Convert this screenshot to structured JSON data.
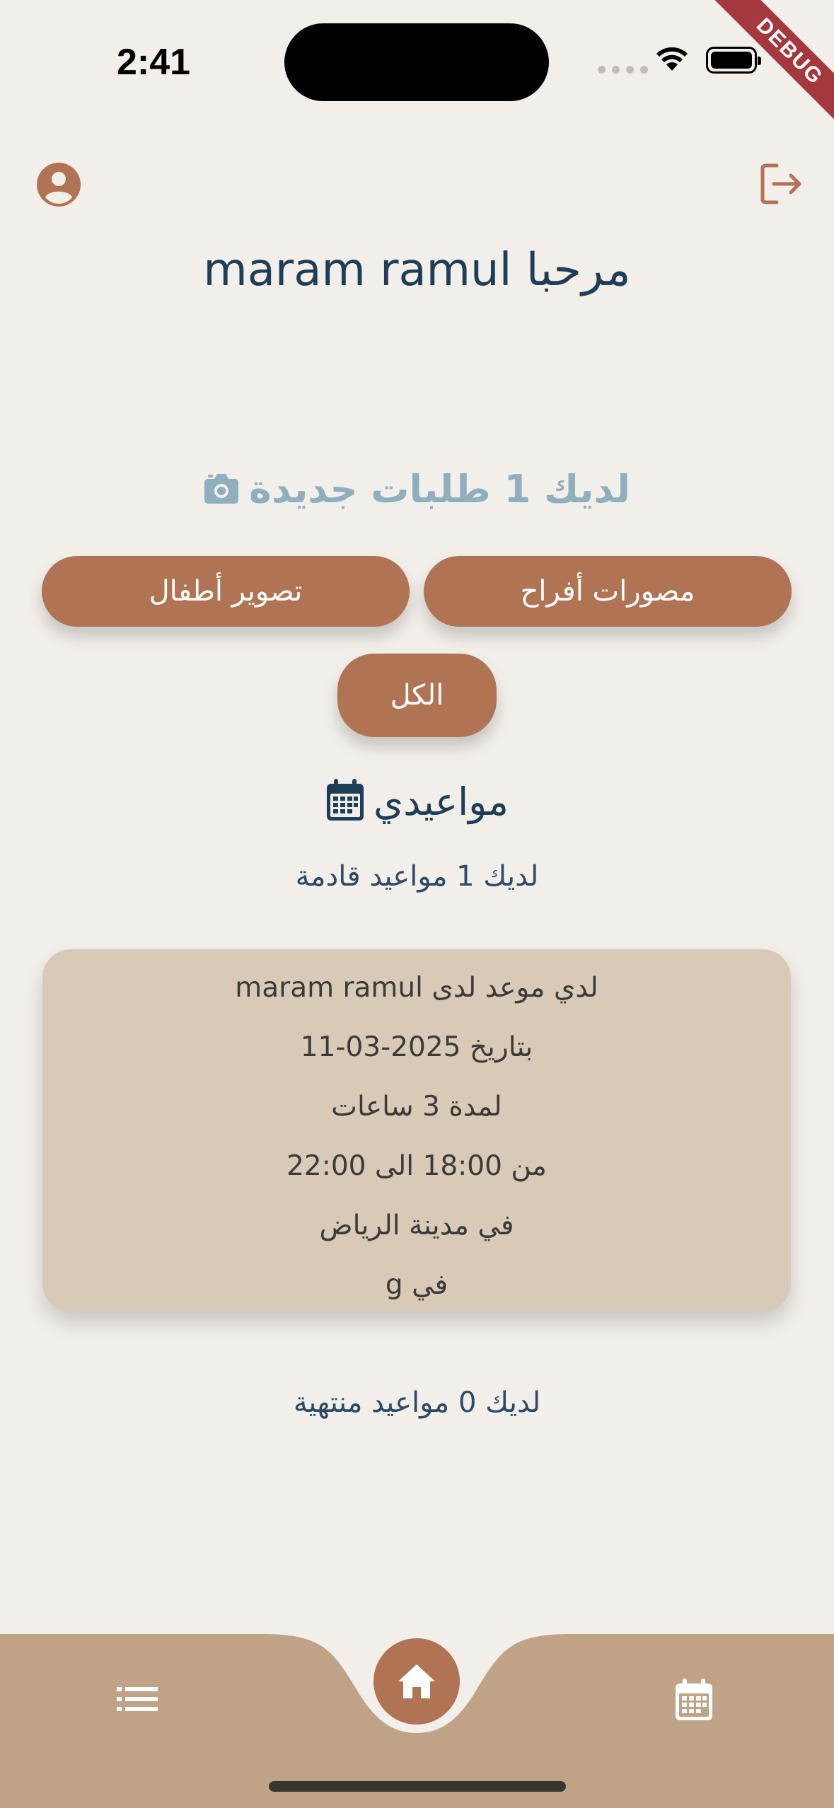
{
  "status_bar": {
    "time": "2:41",
    "debug_label": "DEBUG"
  },
  "header": {
    "title": "مرحبا maram ramul"
  },
  "requests": {
    "text": "لديك 1 طلبات جديدة"
  },
  "filters": {
    "weddings_label": "مصورات أفراح",
    "kids_label": "تصوير أطفال",
    "all_label": "الكل"
  },
  "appointments": {
    "heading": "مواعيدي",
    "upcoming_text": "لديك 1 مواعيد قادمة",
    "card": {
      "line1": "لدي موعد لدى  maram ramul",
      "line2": "بتاريخ 2025-03-11",
      "line3": "لمدة 3 ساعات",
      "line4": "من 18:00 الى 22:00",
      "line5": "في مدينة الرياض",
      "line6": "في g"
    },
    "ended_text": "لديك 0 مواعيد منتهية"
  },
  "colors": {
    "background": "#F2EEE9",
    "accent": "#B07455",
    "title": "#1E3E57",
    "requests": "#8FAEBE",
    "card": "#D8CAB7",
    "nav": "#C0A287"
  },
  "icons": {
    "profile": "account-circle-icon",
    "logout": "logout-icon",
    "camera": "camera-icon",
    "calendar": "calendar-icon",
    "list": "list-icon",
    "home": "home-icon"
  }
}
